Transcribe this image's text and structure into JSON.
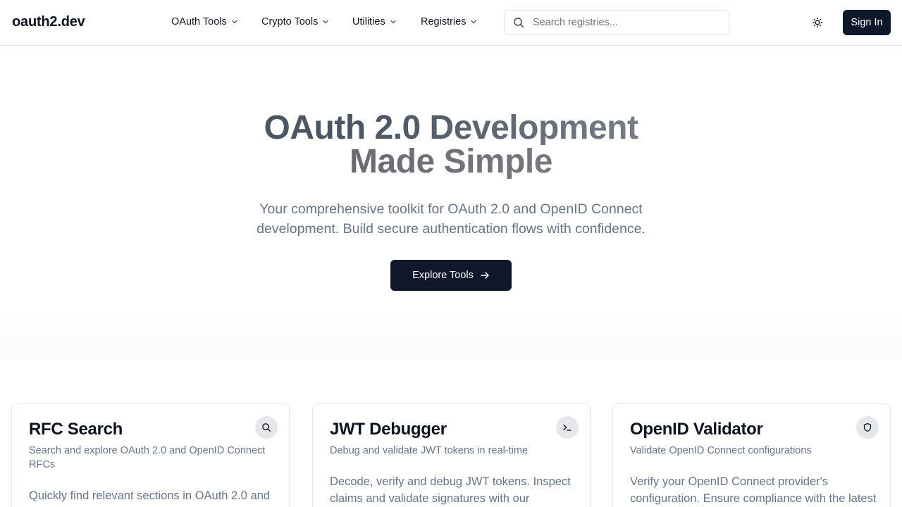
{
  "header": {
    "logo": "oauth2.dev",
    "nav": [
      {
        "label": "OAuth Tools"
      },
      {
        "label": "Crypto Tools"
      },
      {
        "label": "Utilities"
      },
      {
        "label": "Registries"
      }
    ],
    "search": {
      "placeholder": "Search registries...",
      "value": ""
    },
    "theme_icon": "sun-icon",
    "signin_label": "Sign In"
  },
  "hero": {
    "title_part1": "OAuth 2.0 Development",
    "title_part2": "Made Simple",
    "subtitle": "Your comprehensive toolkit for OAuth 2.0 and OpenID Connect development. Build secure authentication flows with confidence.",
    "cta_label": "Explore Tools",
    "cta_icon": "arrow-right-icon"
  },
  "cards": [
    {
      "title": "RFC Search",
      "subtitle": "Search and explore OAuth 2.0 and OpenID Connect RFCs",
      "description": "Quickly find relevant sections in OAuth 2.0 and",
      "icon": "search-icon"
    },
    {
      "title": "JWT Debugger",
      "subtitle": "Debug and validate JWT tokens in real-time",
      "description": "Decode, verify and debug JWT tokens. Inspect claims and validate signatures with our powerful",
      "icon": "terminal-icon"
    },
    {
      "title": "OpenID Validator",
      "subtitle": "Validate OpenID Connect configurations",
      "description": "Verify your OpenID Connect provider's configuration. Ensure compliance with the latest",
      "icon": "shield-icon"
    }
  ],
  "colors": {
    "primary": "#0f172a",
    "muted_text": "#64748b",
    "border": "#e5e7eb"
  }
}
